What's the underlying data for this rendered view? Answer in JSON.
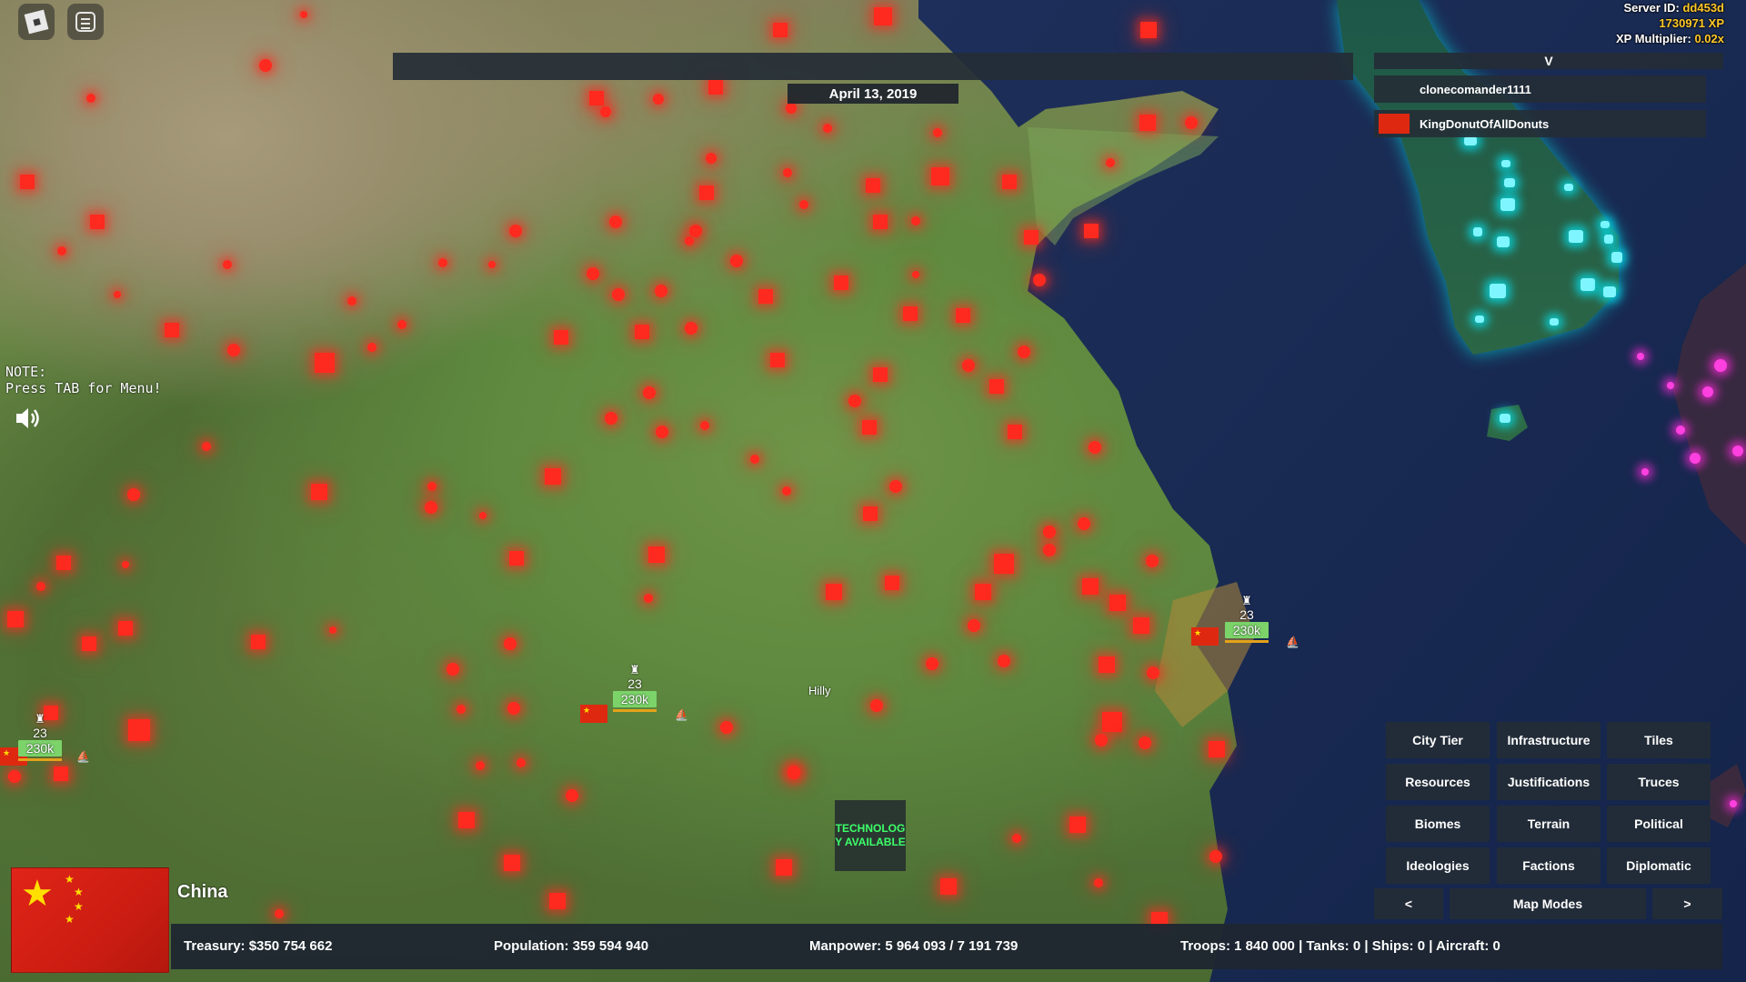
{
  "header": {
    "date": "April 13, 2019",
    "server_id_label": "Server ID:",
    "server_id": "dd453d",
    "xp": "1730971 XP",
    "xp_multiplier_label": "XP Multiplier:",
    "xp_multiplier": "0.02x"
  },
  "player_list": {
    "toggle_label": "V",
    "players": [
      {
        "name": "clonecomander1111",
        "flag": ""
      },
      {
        "name": "KingDonutOfAllDonuts",
        "flag": "china-flag"
      }
    ]
  },
  "note": {
    "line1": "NOTE:",
    "line2": "Press TAB for Menu!"
  },
  "map": {
    "terrain_label": "Hilly",
    "tech_notice": "TECHNOLOGY AVAILABLE"
  },
  "armies": [
    {
      "level": "23",
      "troops": "230k"
    },
    {
      "level": "23",
      "troops": "230k"
    },
    {
      "level": "23",
      "troops": "230k"
    }
  ],
  "map_modes": {
    "buttons": [
      "City Tier",
      "Infrastructure",
      "Tiles",
      "Resources",
      "Justifications",
      "Truces",
      "Biomes",
      "Terrain",
      "Political",
      "Ideologies",
      "Factions",
      "Diplomatic"
    ],
    "prev_label": "<",
    "title": "Map Modes",
    "next_label": ">"
  },
  "country": {
    "name": "China",
    "flag": "china-flag"
  },
  "stats": {
    "treasury": "Treasury:  $350 754 662",
    "population": "Population: 359 594 940",
    "manpower": "Manpower:  5 964 093  /  7 191 739",
    "military": "Troops: 1 840 000  |  Tanks: 0  |  Ships: 0  |  Aircraft: 0"
  },
  "colors": {
    "china_cities": "#ff2a1f",
    "korea_cities": "#7ff6ff",
    "japan_cities": "#ff40e0",
    "panel_bg": "#242c36",
    "tech_text": "#3dff6a",
    "troop_badge": "#7bd36a",
    "server_highlight": "#ffc928"
  }
}
